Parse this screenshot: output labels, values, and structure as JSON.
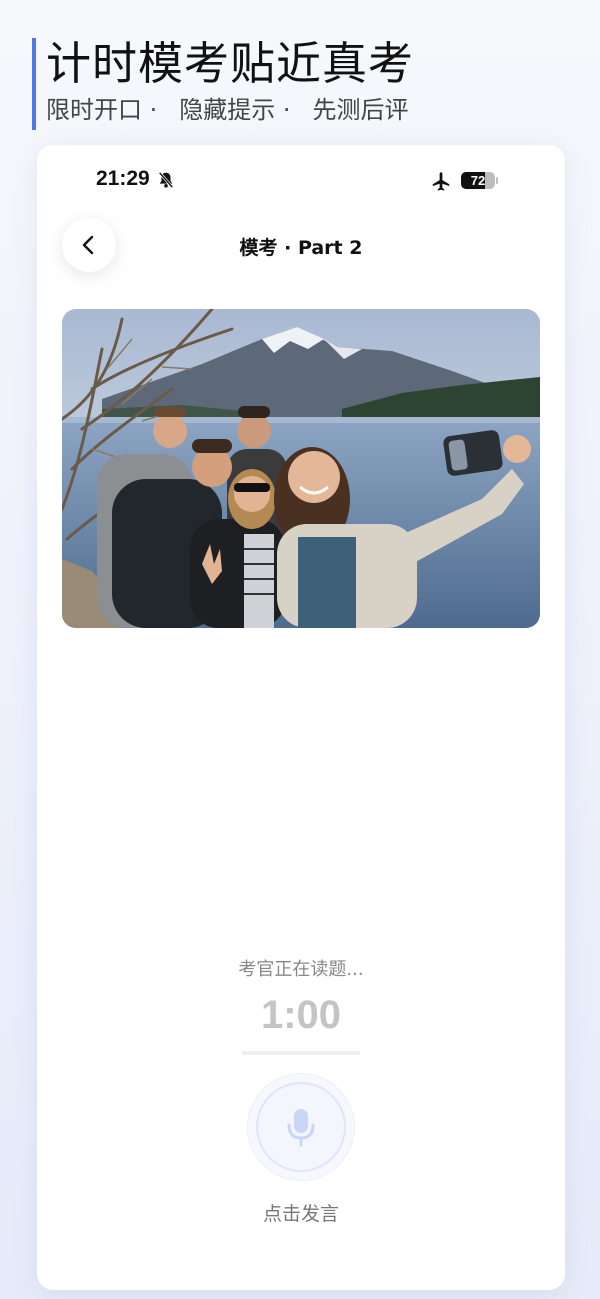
{
  "promo": {
    "title": "计时模考贴近真考",
    "subtitle_items": [
      "限时开口 ·",
      "隐藏提示 ·",
      "先测后评"
    ]
  },
  "status_bar": {
    "time": "21:29",
    "battery_percent": "72",
    "battery_level": 0.72,
    "icons": [
      "bell-muted-icon",
      "airplane-icon",
      "battery-icon"
    ]
  },
  "nav": {
    "title": "模考 · Part 2",
    "back_icon": "chevron-left-icon"
  },
  "exam": {
    "prompt": "考官正在读题...",
    "timer": "1:00",
    "mic_label": "点击发言",
    "mic_icon": "microphone-icon"
  },
  "colors": {
    "accent": "#4f78e6",
    "mic_accent": "#c9d6f8",
    "timer_gray": "#c4c4c4"
  }
}
